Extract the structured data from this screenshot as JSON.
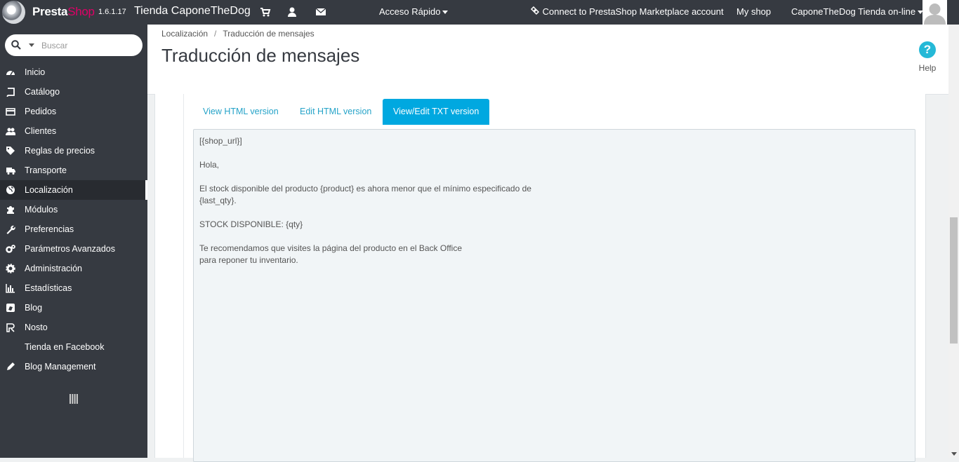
{
  "topbar": {
    "logo_part1": "Presta",
    "logo_part2": "Shop",
    "version": "1.6.1.17",
    "shop_name": "Tienda CaponeTheDog",
    "quick_access": "Acceso Rápido",
    "connect": "Connect to PrestaShop Marketplace account",
    "my_shop": "My shop",
    "shop_selector": "CaponeTheDog Tienda on-line"
  },
  "sidebar": {
    "search_placeholder": "Buscar",
    "items": [
      {
        "label": "Inicio",
        "icon": "dashboard-icon"
      },
      {
        "label": "Catálogo",
        "icon": "book-icon"
      },
      {
        "label": "Pedidos",
        "icon": "credit-card-icon"
      },
      {
        "label": "Clientes",
        "icon": "users-icon"
      },
      {
        "label": "Reglas de precios",
        "icon": "tags-icon"
      },
      {
        "label": "Transporte",
        "icon": "truck-icon"
      },
      {
        "label": "Localización",
        "icon": "globe-icon",
        "active": true
      },
      {
        "label": "Módulos",
        "icon": "puzzle-icon"
      },
      {
        "label": "Preferencias",
        "icon": "wrench-icon"
      },
      {
        "label": "Parámetros Avanzados",
        "icon": "cogs-icon"
      },
      {
        "label": "Administración",
        "icon": "cog-icon"
      },
      {
        "label": "Estadísticas",
        "icon": "bar-chart-icon"
      },
      {
        "label": "Blog",
        "icon": "blog-icon"
      },
      {
        "label": "Nosto",
        "icon": "nosto-icon"
      },
      {
        "label": "Tienda en Facebook",
        "icon": ""
      },
      {
        "label": "Blog Management",
        "icon": "pencil-icon"
      }
    ]
  },
  "header": {
    "breadcrumb": [
      "Localización",
      "Traducción de mensajes"
    ],
    "breadcrumb_sep": "/",
    "title": "Traducción de mensajes",
    "help_label": "Help",
    "help_glyph": "?"
  },
  "tabs": [
    {
      "label": "View HTML version",
      "active": false
    },
    {
      "label": "Edit HTML version",
      "active": false
    },
    {
      "label": "View/Edit TXT version",
      "active": true
    }
  ],
  "txt_content": "[{shop_url}]\n\nHola,\n\nEl stock disponible del producto {product} es ahora menor que el mínimo especificado de\n{last_qty}.\n\nSTOCK DISPONIBLE: {qty}\n\nTe recomendamos que visites la página del producto en el Back Office\npara reponer tu inventario.",
  "colors": {
    "topbar_bg": "#363a41",
    "accent": "#25b9d7",
    "active_tab": "#00a8e0",
    "brand_pink": "#df0067"
  }
}
